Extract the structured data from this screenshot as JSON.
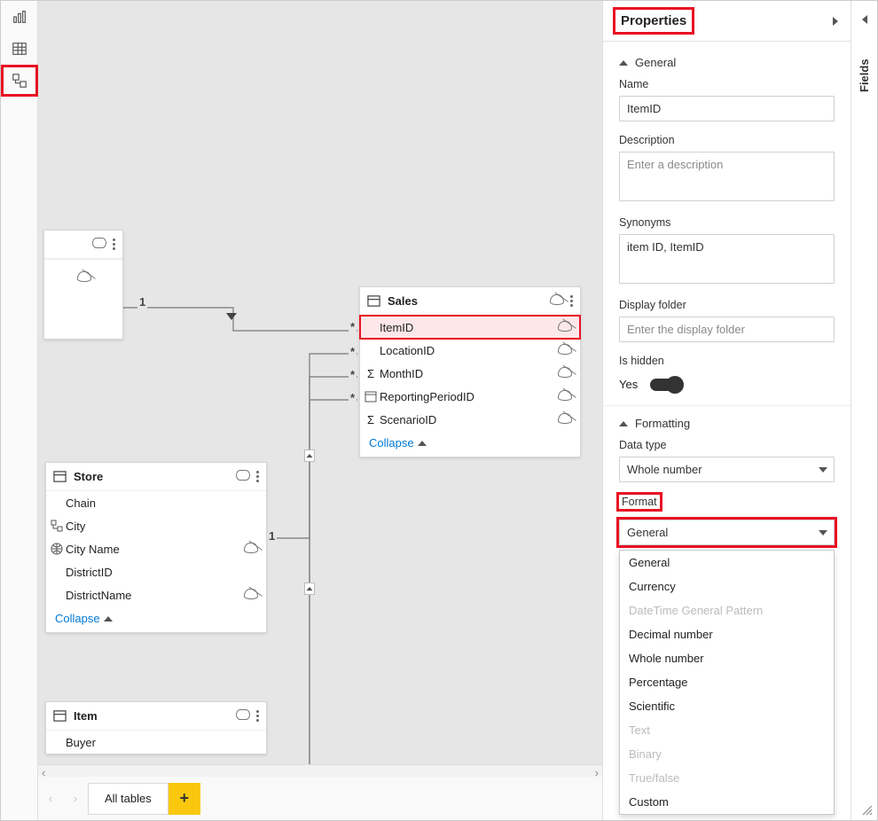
{
  "properties": {
    "title": "Properties",
    "general": {
      "heading": "General",
      "name_label": "Name",
      "name_value": "ItemID",
      "description_label": "Description",
      "description_placeholder": "Enter a description",
      "synonyms_label": "Synonyms",
      "synonyms_value": "item ID, ItemID",
      "display_folder_label": "Display folder",
      "display_folder_placeholder": "Enter the display folder",
      "is_hidden_label": "Is hidden",
      "is_hidden_value": "Yes"
    },
    "formatting": {
      "heading": "Formatting",
      "data_type_label": "Data type",
      "data_type_value": "Whole number",
      "format_label": "Format",
      "format_value": "General",
      "format_options": [
        {
          "label": "General",
          "disabled": false
        },
        {
          "label": "Currency",
          "disabled": false
        },
        {
          "label": "DateTime General Pattern",
          "disabled": true
        },
        {
          "label": "Decimal number",
          "disabled": false
        },
        {
          "label": "Whole number",
          "disabled": false
        },
        {
          "label": "Percentage",
          "disabled": false
        },
        {
          "label": "Scientific",
          "disabled": false
        },
        {
          "label": "Text",
          "disabled": true
        },
        {
          "label": "Binary",
          "disabled": true
        },
        {
          "label": "True/false",
          "disabled": true
        },
        {
          "label": "Custom",
          "disabled": false
        }
      ]
    }
  },
  "fields_panel_label": "Fields",
  "canvas": {
    "tables": {
      "sales": {
        "name": "Sales",
        "fields": [
          {
            "name": "ItemID",
            "icon": "none",
            "hidden": true,
            "selected": true
          },
          {
            "name": "LocationID",
            "icon": "none",
            "hidden": true,
            "selected": false
          },
          {
            "name": "MonthID",
            "icon": "sigma",
            "hidden": true,
            "selected": false
          },
          {
            "name": "ReportingPeriodID",
            "icon": "date",
            "hidden": true,
            "selected": false
          },
          {
            "name": "ScenarioID",
            "icon": "sigma",
            "hidden": true,
            "selected": false
          }
        ],
        "collapse": "Collapse"
      },
      "store": {
        "name": "Store",
        "fields": [
          {
            "name": "Chain",
            "icon": "none",
            "hidden": false
          },
          {
            "name": "City",
            "icon": "hier",
            "hidden": false
          },
          {
            "name": "City Name",
            "icon": "globe",
            "hidden": true
          },
          {
            "name": "DistrictID",
            "icon": "none",
            "hidden": false
          },
          {
            "name": "DistrictName",
            "icon": "none",
            "hidden": true
          }
        ],
        "collapse": "Collapse"
      },
      "item": {
        "name": "Item",
        "fields": [
          {
            "name": "Buyer",
            "icon": "none",
            "hidden": false
          }
        ]
      }
    },
    "relationship_labels": {
      "one": "1",
      "many": "*"
    }
  },
  "bottom": {
    "tab_label": "All tables"
  }
}
